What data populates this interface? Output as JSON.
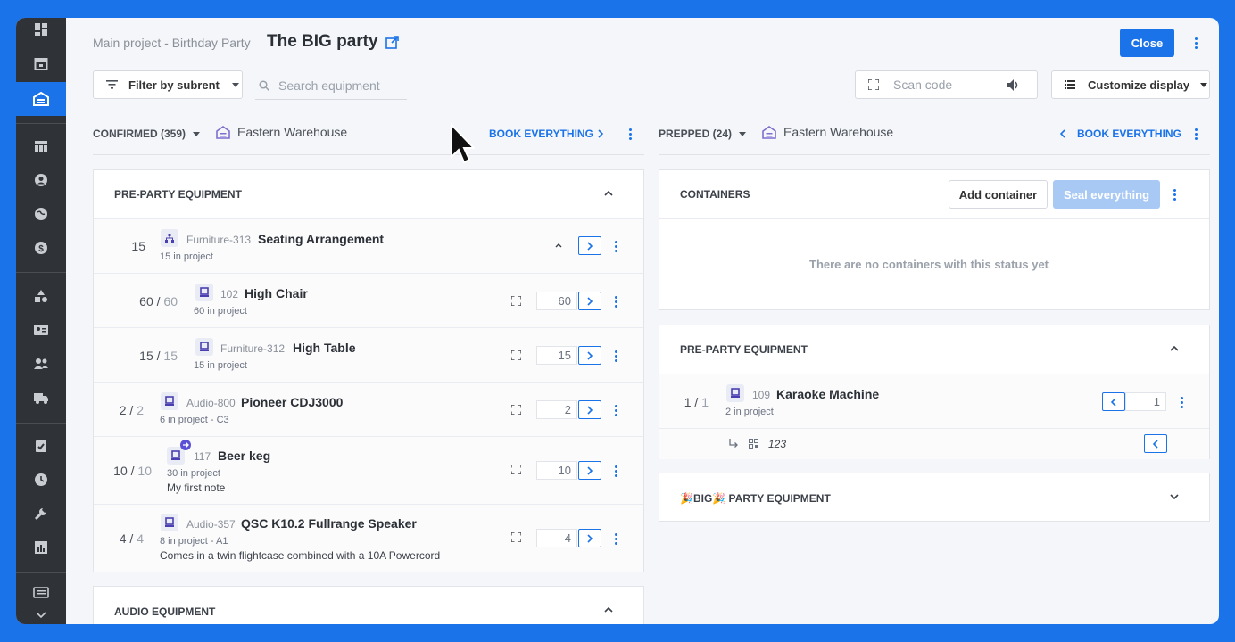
{
  "header": {
    "breadcrumb": "Main project - Birthday Party",
    "title": "The BIG party",
    "close_label": "Close"
  },
  "toolbar": {
    "filter_label": "Filter by subrent",
    "search_placeholder": "Search equipment",
    "scan_placeholder": "Scan code",
    "customize_label": "Customize display"
  },
  "left_column": {
    "status_label": "CONFIRMED (359)",
    "warehouse": "Eastern Warehouse",
    "book_label": "BOOK EVERYTHING",
    "group_title": "PRE-PARTY EQUIPMENT",
    "items": [
      {
        "qty": "15",
        "qty_total": "",
        "code": "Furniture-313",
        "name": "Seating Arrangement",
        "sub": "15 in project",
        "note": "",
        "input": ""
      },
      {
        "qty": "60 /",
        "qty_total": "60",
        "code": "102",
        "name": "High Chair",
        "sub": "60 in project",
        "note": "",
        "input": "60"
      },
      {
        "qty": "15 /",
        "qty_total": "15",
        "code": "Furniture-312",
        "name": "High Table",
        "sub": "15 in project",
        "note": "",
        "input": "15"
      },
      {
        "qty": "2 /",
        "qty_total": "2",
        "code": "Audio-800",
        "name": "Pioneer CDJ3000",
        "sub": "6 in project - C3",
        "note": "",
        "input": "2"
      },
      {
        "qty": "10 /",
        "qty_total": "10",
        "code": "117",
        "name": "Beer keg",
        "sub": "30 in project",
        "note": "My first note",
        "input": "10"
      },
      {
        "qty": "4 /",
        "qty_total": "4",
        "code": "Audio-357",
        "name": "QSC K10.2 Fullrange Speaker",
        "sub": "8 in project - A1",
        "note": "Comes in a twin flightcase combined with a 10A Powercord",
        "input": "4"
      }
    ],
    "group2_title": "AUDIO EQUIPMENT"
  },
  "right_column": {
    "status_label": "PREPPED (24)",
    "warehouse": "Eastern Warehouse",
    "book_label": "BOOK EVERYTHING",
    "containers_title": "CONTAINERS",
    "add_container_label": "Add container",
    "seal_label": "Seal everything",
    "empty_message": "There are no containers with this status yet",
    "group_title": "PRE-PARTY EQUIPMENT",
    "item": {
      "qty": "1 /",
      "qty_total": "1",
      "code": "109",
      "name": "Karaoke Machine",
      "sub": "2 in project",
      "input": "1",
      "serial": "123"
    },
    "group2_title": "🎉BIG🎉 PARTY EQUIPMENT"
  },
  "colors": {
    "accent": "#1a73e8",
    "sidebar": "#2f3237",
    "background": "#f4f6f9"
  }
}
